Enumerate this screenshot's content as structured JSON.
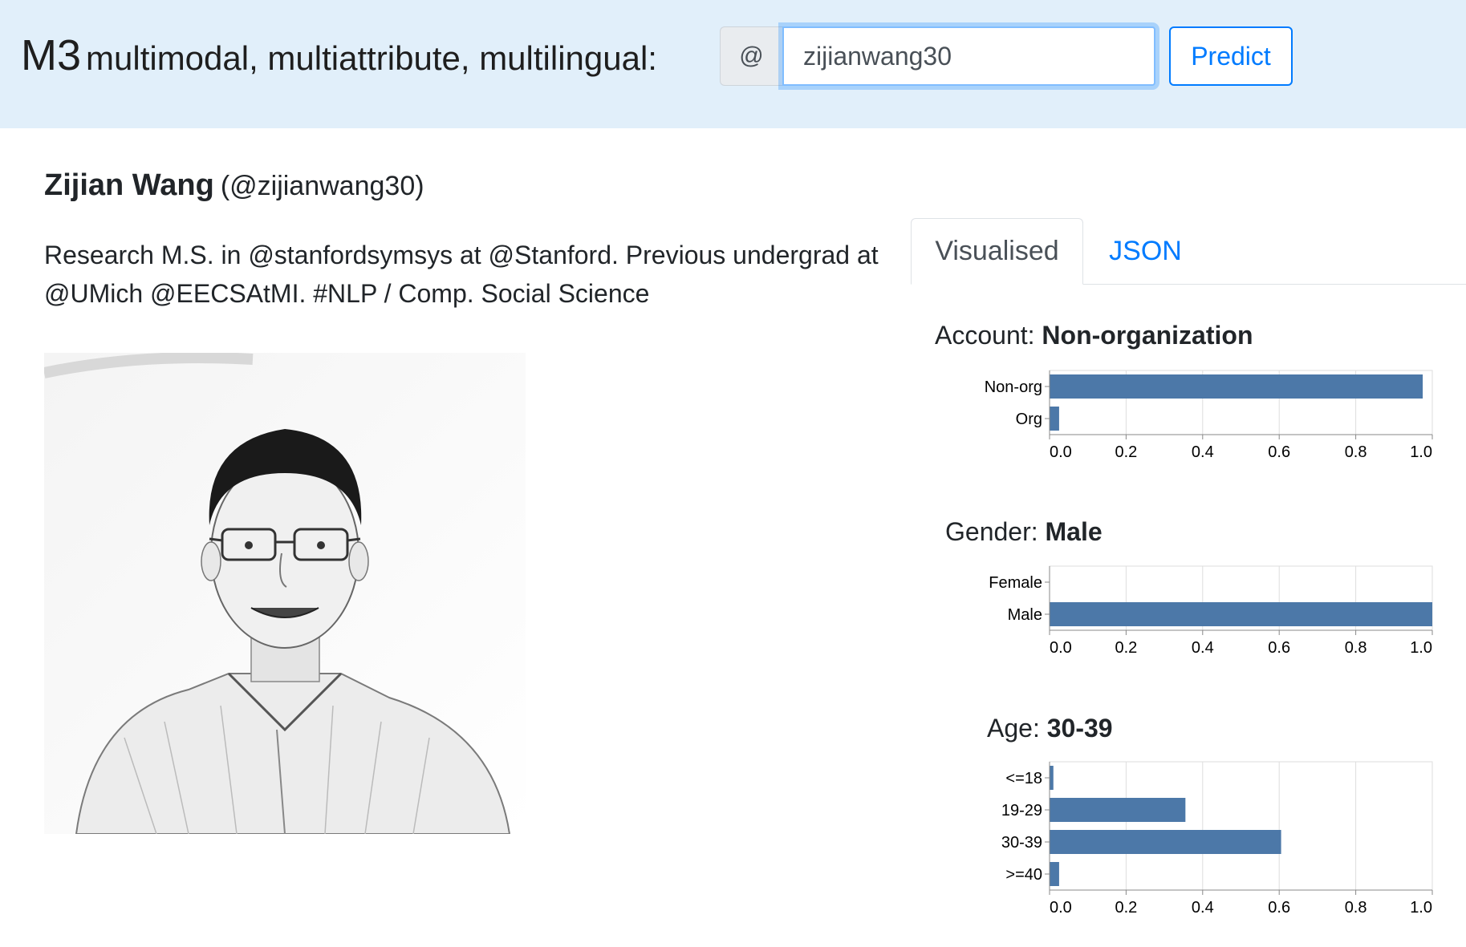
{
  "header": {
    "brand_big": "M3",
    "brand_tagline": "multimodal, multiattribute, multilingual:",
    "at_symbol": "@",
    "handle_value": "zijianwang30",
    "predict_label": "Predict"
  },
  "profile": {
    "name": "Zijian Wang",
    "handle": "(@zijianwang30)",
    "bio": "Research M.S. in @stanfordsymsys at @Stanford. Previous undergrad at @UMich @EECSAtMI. #NLP / Comp. Social Science"
  },
  "tabs": [
    {
      "label": "Visualised",
      "active": true
    },
    {
      "label": "JSON",
      "active": false
    }
  ],
  "colors": {
    "bar": "#4c78a8",
    "accent": "#007bff",
    "header_bg": "#e1effa"
  },
  "chart_data": [
    {
      "type": "bar",
      "orientation": "horizontal",
      "title_prefix": "Account:",
      "title_value": "Non-organization",
      "categories": [
        "Non-org",
        "Org"
      ],
      "values": [
        0.975,
        0.025
      ],
      "xlim": [
        0,
        1
      ],
      "xticks": [
        "0.0",
        "0.2",
        "0.4",
        "0.6",
        "0.8",
        "1.0"
      ],
      "grid": true
    },
    {
      "type": "bar",
      "orientation": "horizontal",
      "title_prefix": "Gender:",
      "title_value": "Male",
      "categories": [
        "Female",
        "Male"
      ],
      "values": [
        0.0,
        1.0
      ],
      "xlim": [
        0,
        1
      ],
      "xticks": [
        "0.0",
        "0.2",
        "0.4",
        "0.6",
        "0.8",
        "1.0"
      ],
      "grid": true
    },
    {
      "type": "bar",
      "orientation": "horizontal",
      "title_prefix": "Age:",
      "title_value": "30-39",
      "categories": [
        "<=18",
        "19-29",
        "30-39",
        ">=40"
      ],
      "values": [
        0.01,
        0.355,
        0.605,
        0.025
      ],
      "xlim": [
        0,
        1
      ],
      "xticks": [
        "0.0",
        "0.2",
        "0.4",
        "0.6",
        "0.8",
        "1.0"
      ],
      "grid": true
    }
  ]
}
